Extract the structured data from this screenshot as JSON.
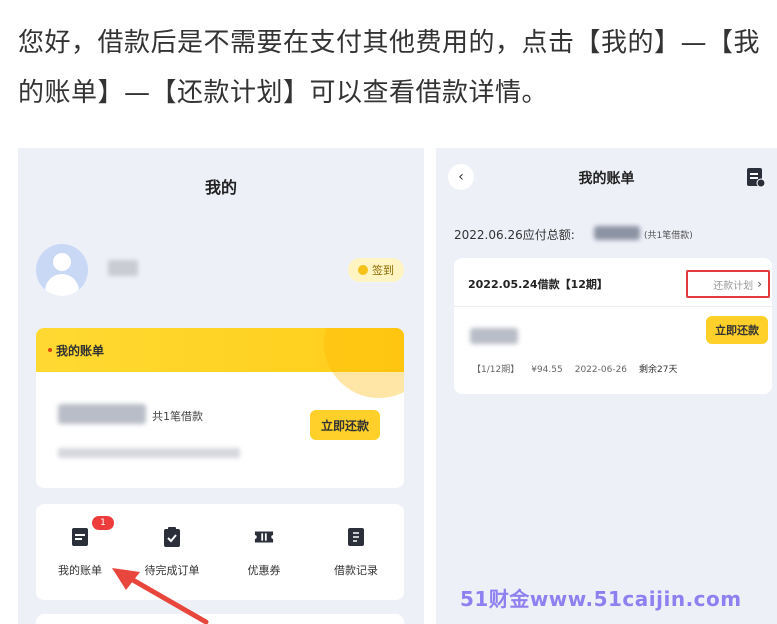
{
  "instruction": {
    "text": "您好，借款后是不需要在支付其他费用的，点击【我的】—【我的账单】—【还款计划】可以查看借款详情。"
  },
  "left_screen": {
    "title": "我的",
    "checkin_label": "签到",
    "bill_card": {
      "header": "我的账单",
      "loan_count": "共1笔借款",
      "repay_button": "立即还款"
    },
    "menu": [
      {
        "label": "我的账单",
        "icon": "bill-icon",
        "badge": "1"
      },
      {
        "label": "待完成订单",
        "icon": "clipboard-icon"
      },
      {
        "label": "优惠券",
        "icon": "coupon-icon"
      },
      {
        "label": "借款记录",
        "icon": "record-icon"
      }
    ]
  },
  "right_screen": {
    "title": "我的账单",
    "back_icon": "‹",
    "due_label": "2022.06.26应付总额:",
    "due_count": "(共1笔借款)",
    "loan": {
      "date": "2022.05.24借款【12期】",
      "plan_link": "还款计划",
      "repay_button": "立即还款",
      "period": "【1/12期】",
      "amount": "¥94.55",
      "due_date": "2022-06-26",
      "remain": "剩余27天"
    }
  },
  "watermark": "51财金www.51caijin.com",
  "colors": {
    "accent_yellow": "#ffd02a",
    "panel_bg": "#eef0f8",
    "highlight_red": "#e03a3a",
    "arrow_red": "#e8463c",
    "watermark": "#8f7ff0"
  }
}
